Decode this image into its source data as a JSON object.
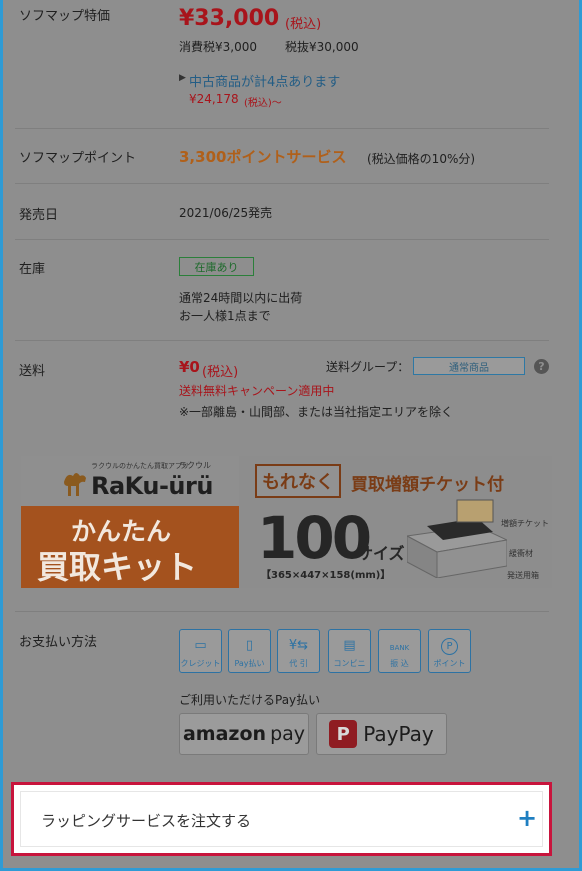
{
  "price_section": {
    "label": "ソフマップ特価",
    "price": "¥33,000",
    "tax_note": "(税込)",
    "consumption_tax": "消費税¥3,000",
    "ex_tax": "税抜¥30,000",
    "used_link": "中古商品が計4点あります",
    "used_price": "¥24,178",
    "used_price_suffix": "(税込)～"
  },
  "points": {
    "label": "ソフマップポイント",
    "value": "3,300ポイントサービス",
    "note": "(税込価格の10%分)"
  },
  "release": {
    "label": "発売日",
    "value": "2021/06/25発売"
  },
  "stock": {
    "label": "在庫",
    "badge": "在庫あり",
    "line1": "通常24時間以内に出荷",
    "line2": "お一人様1点まで"
  },
  "shipping": {
    "label": "送料",
    "price": "¥0",
    "tax_note": "(税込)",
    "group_label": "送料グループ：",
    "group_value": "通常商品",
    "help": "?",
    "campaign": "送料無料キャンペーン適用中",
    "note": "※一部離島・山間部、または当社指定エリアを除く"
  },
  "banner": {
    "small_caption": "ラクウルのかんたん買取アプリ",
    "brand_small": "ラクウル",
    "logo": "RaKu-ürü",
    "left_line1": "かんたん",
    "left_line2": "買取キット",
    "moreaku": "もれなく",
    "ticket_headline": "買取増額チケット付",
    "size_number": "100",
    "size_label": "サイズ",
    "dimensions": "【365×447×158(mm)】",
    "ticket_label": "増額チケット",
    "cushion_label": "緩衝材",
    "box_label": "発送用箱"
  },
  "payment": {
    "label": "お支払い方法",
    "methods": [
      {
        "label": "クレジット",
        "icon": "credit-card-icon",
        "symbol": "▭"
      },
      {
        "label": "Pay払い",
        "icon": "mobile-pay-icon",
        "symbol": "▯"
      },
      {
        "label": "代 引",
        "icon": "cash-on-delivery-icon",
        "symbol": "¥⇆"
      },
      {
        "label": "コンビニ",
        "icon": "convenience-store-icon",
        "symbol": "▤"
      },
      {
        "label": "振 込",
        "icon": "bank-transfer-icon",
        "symbol": "BANK"
      },
      {
        "label": "ポイント",
        "icon": "points-icon",
        "symbol": "P"
      }
    ],
    "pay_label": "ご利用いただけるPay払い",
    "amazon_brand": "amazon",
    "amazon_pay": "pay",
    "paypay_mark": "P",
    "paypay": "PayPay"
  },
  "wrapping": {
    "label": "ラッピングサービスを注文する",
    "expand": "+"
  },
  "colors": {
    "frame": "#2f9bd5",
    "highlight": "#c8143c",
    "price": "#a8141b",
    "accent_blue": "#1f7fc1"
  }
}
